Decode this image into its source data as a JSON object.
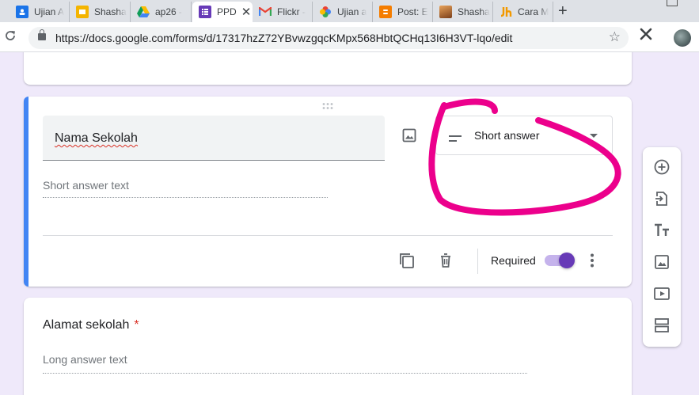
{
  "browser": {
    "tabs": [
      {
        "label": "Ujian A",
        "favicon": "classroom-icon",
        "color": "#1a73e8"
      },
      {
        "label": "Shasha",
        "favicon": "slides-icon",
        "color": "#f4b400"
      },
      {
        "label": "ap26 -",
        "favicon": "drive-icon",
        "color": "#0f9d58"
      },
      {
        "label": "PPD",
        "favicon": "forms-icon",
        "color": "#673ab7",
        "active": true
      },
      {
        "label": "Flickr -",
        "favicon": "gmail-icon",
        "color": "#ea4335"
      },
      {
        "label": "Ujian a",
        "favicon": "photos-icon",
        "color": "#fbbc04"
      },
      {
        "label": "Post: E",
        "favicon": "blogger-icon",
        "color": "#f57d00"
      },
      {
        "label": "Shasha",
        "favicon": "image-icon",
        "color": "#b5651d"
      },
      {
        "label": "Cara M",
        "favicon": "jh-icon",
        "color": "#f29900"
      }
    ],
    "close_glyph": "✕",
    "new_tab_glyph": "+",
    "url": "https://docs.google.com/forms/d/17317hzZ72YBvwzgqcKMpx568HbtQCHq13I6H3VT-lqo/edit"
  },
  "form": {
    "question1": {
      "title": "Nama Sekolah",
      "type_label": "Short answer",
      "placeholder": "Short answer text",
      "required_label": "Required",
      "required": true
    },
    "question2": {
      "title": "Alamat sekolah",
      "required_marker": "*",
      "placeholder": "Long answer text"
    }
  },
  "colors": {
    "accent": "#673ab7",
    "active_border": "#4285f4",
    "annotation": "#ec008c",
    "background": "#efe9fa"
  }
}
